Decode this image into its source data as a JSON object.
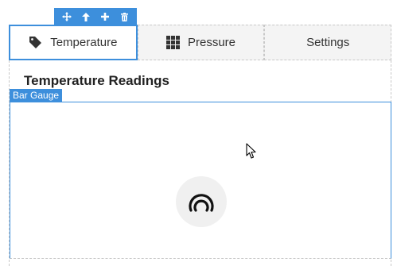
{
  "toolbar": {
    "buttons": [
      {
        "icon": "move-icon"
      },
      {
        "icon": "arrow-up-icon"
      },
      {
        "icon": "plus-icon"
      },
      {
        "icon": "trash-icon"
      }
    ],
    "color": "#3d8fdc"
  },
  "tabs": [
    {
      "label": "Temperature",
      "icon": "tag-icon",
      "active": true
    },
    {
      "label": "Pressure",
      "icon": "grid-icon",
      "active": false
    },
    {
      "label": "Settings",
      "icon": "",
      "active": false
    }
  ],
  "panel": {
    "title": "Temperature Readings"
  },
  "widget": {
    "tag_label": "Bar Gauge",
    "loading_icon": "gauge-loading-icon"
  },
  "colors": {
    "accent": "#3d8fdc",
    "tab_inactive_bg": "#f4f4f4",
    "border_dashed": "#c8c8c8"
  }
}
